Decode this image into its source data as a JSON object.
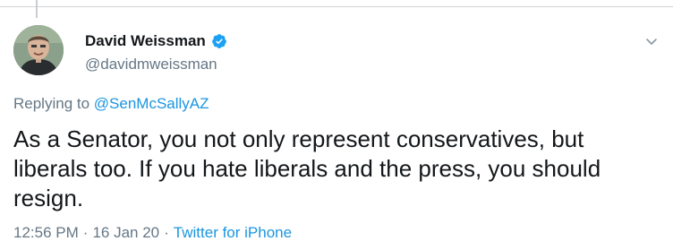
{
  "author": {
    "display_name": "David Weissman",
    "handle": "@davidmweissman",
    "verified": true
  },
  "reply": {
    "prefix": "Replying to",
    "to_handle": "@SenMcSallyAZ"
  },
  "tweet": {
    "text": "As a Senator, you not only represent conservatives, but liberals too. If you hate liberals and the press, you should resign."
  },
  "meta": {
    "time": "12:56 PM",
    "date": "16 Jan 20",
    "source": "Twitter for iPhone",
    "separator": "·"
  },
  "colors": {
    "link": "#1b95e0",
    "secondary_text": "#657786",
    "primary_text": "#14171a",
    "verified_badge": "#1da1f2"
  },
  "icons": {
    "verified": "verified-badge-icon",
    "menu": "chevron-down-icon",
    "avatar": "user-avatar-photo"
  }
}
